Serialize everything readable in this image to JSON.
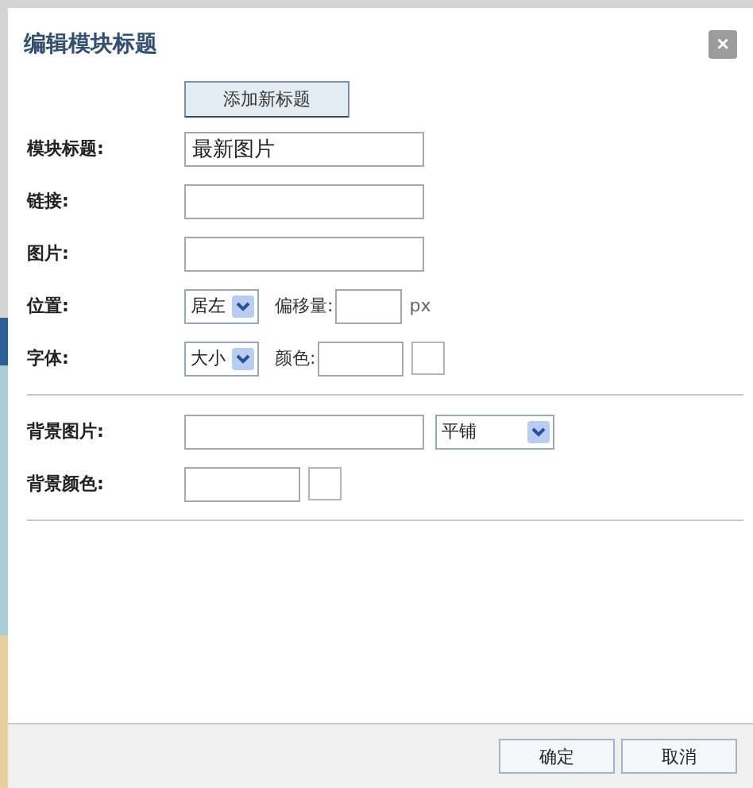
{
  "dialog": {
    "title": "编辑模块标题",
    "close_icon": "×"
  },
  "add_button": "添加新标题",
  "title_row": {
    "label": "模块标题:",
    "value": "最新图片"
  },
  "link_row": {
    "label": "链接:"
  },
  "image_row": {
    "label": "图片:"
  },
  "position_row": {
    "label": "位置:",
    "select": "居左",
    "offset_label": "偏移量:",
    "unit": "px"
  },
  "font_row": {
    "label": "字体:",
    "select": "大小",
    "color_label": "颜色:"
  },
  "bg_image_row": {
    "label": "背景图片:",
    "select": "平铺"
  },
  "bg_color_row": {
    "label": "背景颜色:"
  },
  "buttons": [
    "确定",
    "取消"
  ]
}
